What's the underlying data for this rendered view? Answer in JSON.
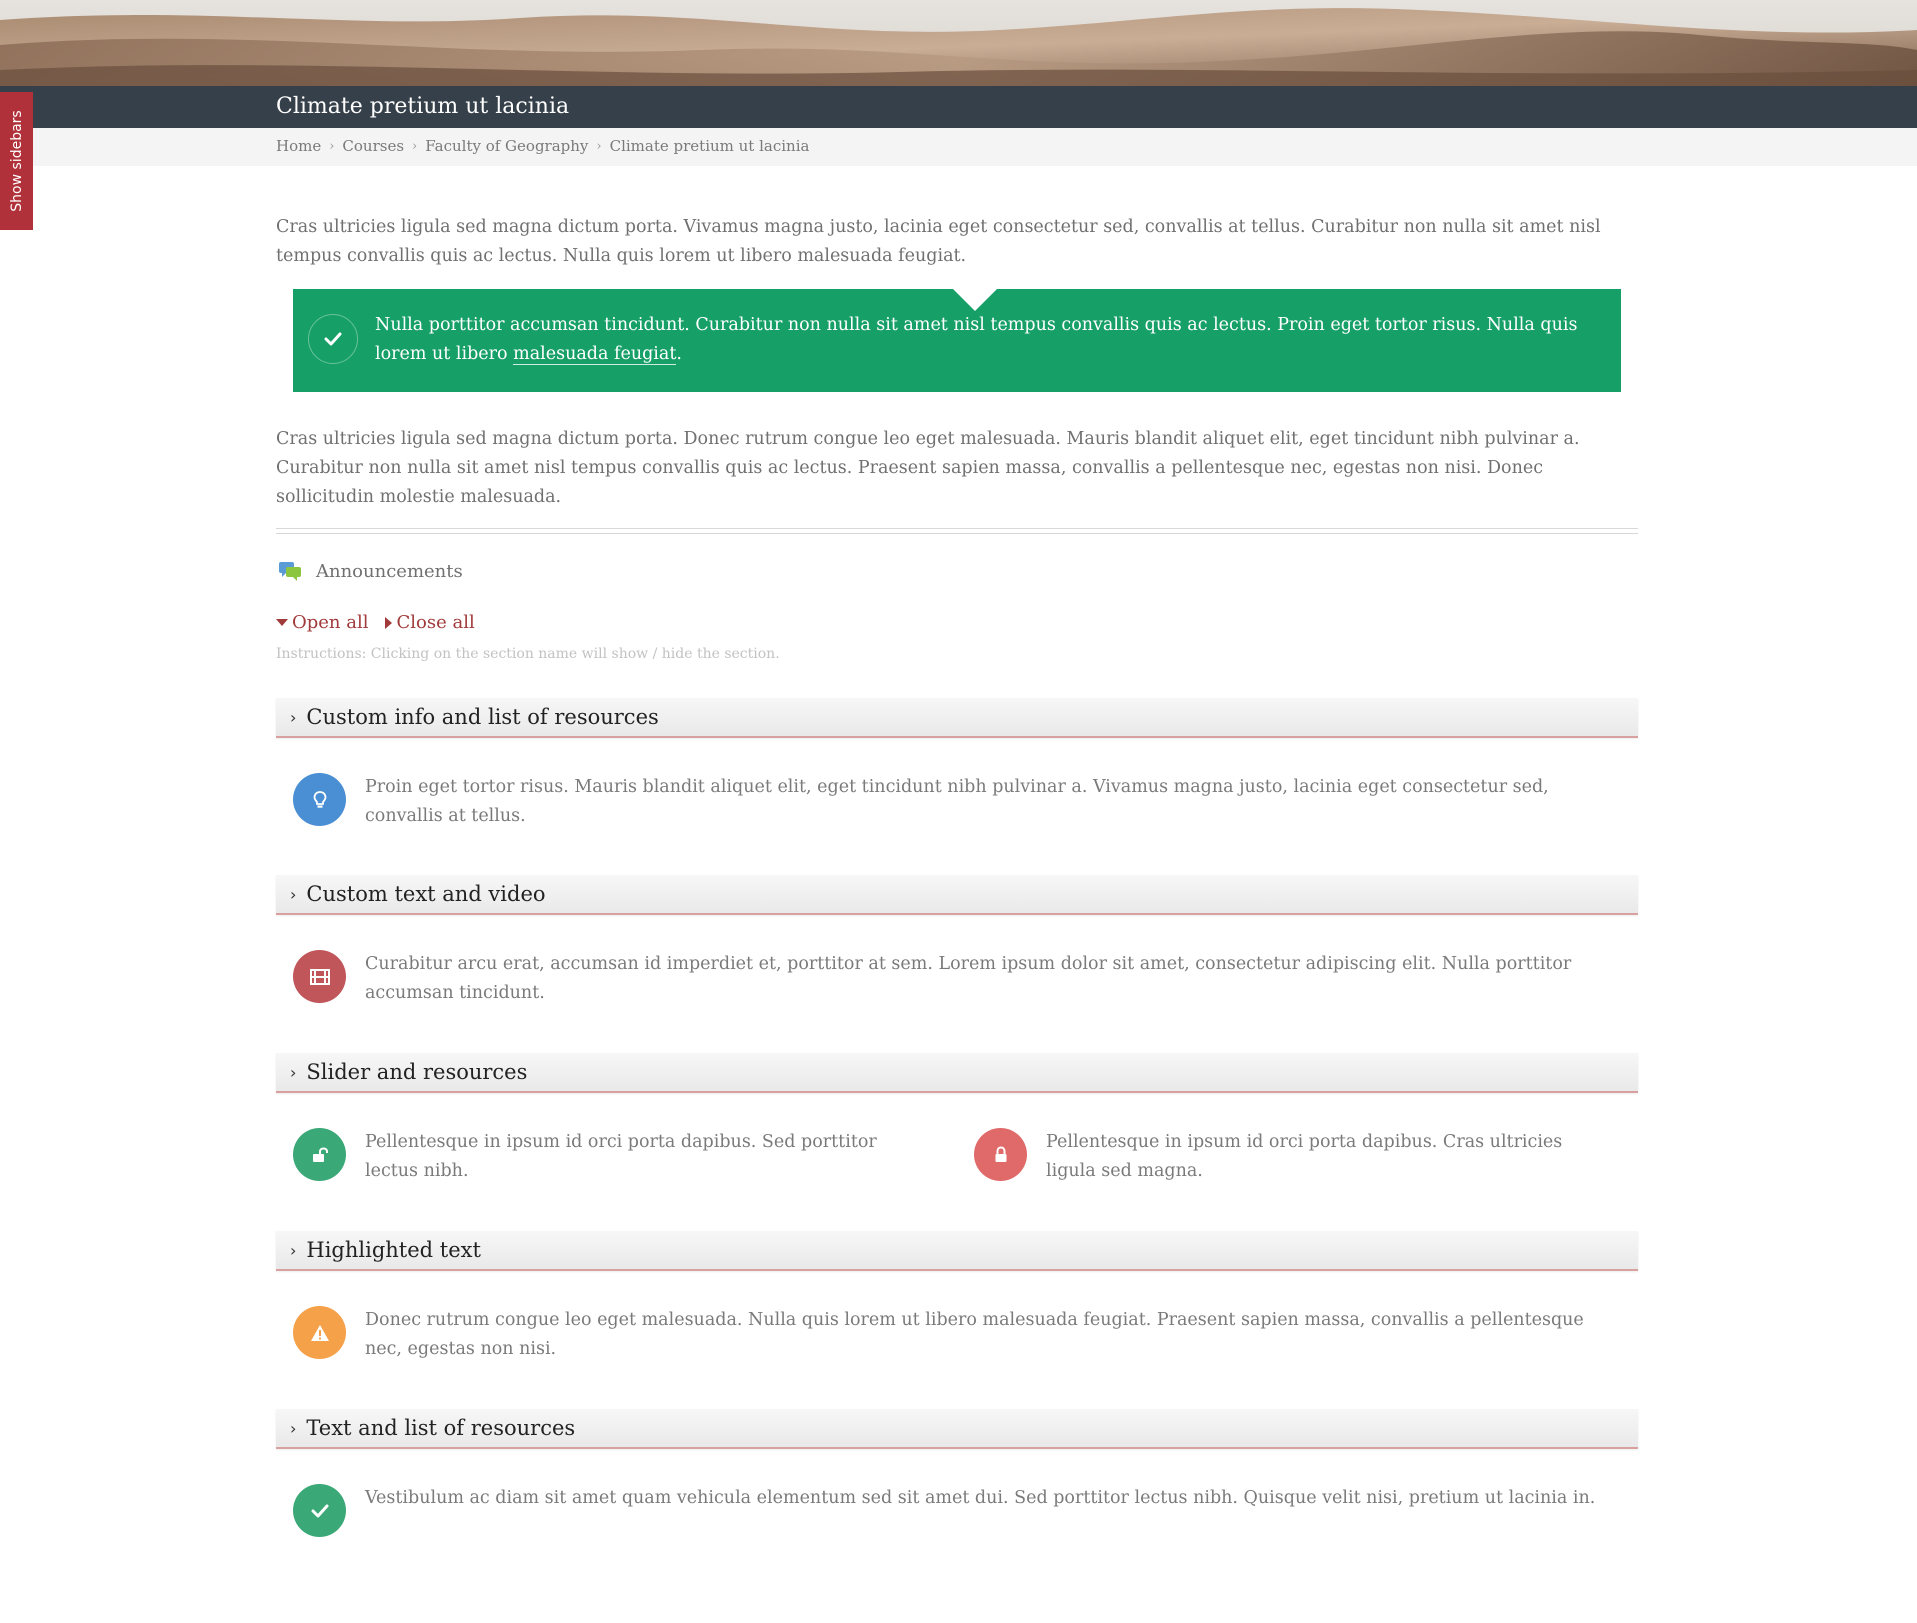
{
  "sidebar_toggle": {
    "label": "Show sidebars"
  },
  "header": {
    "title": "Climate pretium ut lacinia"
  },
  "breadcrumb": {
    "items": [
      "Home",
      "Courses",
      "Faculty of Geography",
      "Climate pretium ut lacinia"
    ]
  },
  "intro": {
    "paragraph1": "Cras ultricies ligula sed magna dictum porta. Vivamus magna justo, lacinia eget consectetur sed, convallis at tellus. Curabitur non nulla sit amet nisl tempus convallis quis ac lectus. Nulla quis lorem ut libero malesuada feugiat.",
    "callout_text": "Nulla porttitor accumsan tincidunt. Curabitur non nulla sit amet nisl tempus convallis quis ac lectus. Proin eget tortor risus. Nulla quis lorem ut libero",
    "callout_link": "malesuada feugiat",
    "callout_end": ".",
    "paragraph2": "Cras ultricies ligula sed magna dictum porta. Donec rutrum congue leo eget malesuada. Mauris blandit aliquet elit, eget tincidunt nibh pulvinar a. Curabitur non nulla sit amet nisl tempus convallis quis ac lectus. Praesent sapien massa, convallis a pellentesque nec, egestas non nisi. Donec sollicitudin molestie malesuada."
  },
  "announcements": {
    "label": "Announcements",
    "icon": "chat-bubbles-icon"
  },
  "toggles": {
    "open_all": "Open all",
    "close_all": "Close all"
  },
  "instructions": "Instructions: Clicking on the section name will show / hide the section.",
  "colors": {
    "accent_red": "#a13a3a",
    "callout_green": "#16a068",
    "title_bar": "#36404a",
    "blue": "#4a8fd4",
    "maroon": "#c0555a",
    "green": "#3aa877",
    "red": "#e06a6a",
    "orange": "#f5a14a"
  },
  "sections": [
    {
      "title": "Custom info and list of resources",
      "items": [
        {
          "icon": "lightbulb-icon",
          "text": "Proin eget tortor risus. Mauris blandit aliquet elit, eget tincidunt nibh pulvinar a. Vivamus magna justo, lacinia eget consectetur sed, convallis at tellus."
        }
      ]
    },
    {
      "title": "Custom text and video",
      "items": [
        {
          "icon": "film-icon",
          "text": "Curabitur arcu erat, accumsan id imperdiet et, porttitor at sem. Lorem ipsum dolor sit amet, consectetur adipiscing elit. Nulla porttitor accumsan tincidunt."
        }
      ]
    },
    {
      "title": "Slider and resources",
      "items": [
        {
          "icon": "unlock-icon",
          "text": "Pellentesque in ipsum id orci porta dapibus. Sed porttitor lectus nibh."
        },
        {
          "icon": "lock-icon",
          "text": "Pellentesque in ipsum id orci porta dapibus. Cras ultricies ligula sed magna."
        }
      ]
    },
    {
      "title": "Highlighted text",
      "items": [
        {
          "icon": "warning-icon",
          "text": "Donec rutrum congue leo eget malesuada. Nulla quis lorem ut libero malesuada feugiat. Praesent sapien massa, convallis a pellentesque nec, egestas non nisi."
        }
      ]
    },
    {
      "title": "Text and list of resources",
      "items": [
        {
          "icon": "check-icon",
          "text": "Vestibulum ac diam sit amet quam vehicula elementum sed sit amet dui. Sed porttitor lectus nibh. Quisque velit nisi, pretium ut lacinia in."
        }
      ]
    }
  ]
}
